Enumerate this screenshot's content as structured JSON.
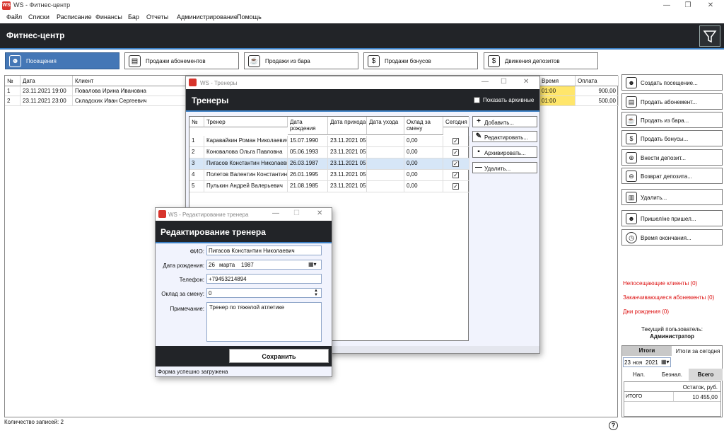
{
  "app": {
    "title": "WS - Фитнес-центр",
    "logo": "WS",
    "header_title": "Фитнес-центр"
  },
  "menu": [
    "Файл",
    "Списки",
    "Расписание",
    "Финансы",
    "Бар",
    "Отчеты",
    "Администрирование",
    "Помощь"
  ],
  "tabs": [
    {
      "label": "Посещения",
      "icon": "person-icon"
    },
    {
      "label": "Продажи абонементов",
      "icon": "ticket-icon"
    },
    {
      "label": "Продажи из бара",
      "icon": "cup-icon"
    },
    {
      "label": "Продажи бонусов",
      "icon": "dollar-icon"
    },
    {
      "label": "Движения депозитов",
      "icon": "dollar-icon"
    }
  ],
  "main_grid": {
    "columns": [
      "№",
      "Дата",
      "Клиент",
      "Время",
      "Оплата"
    ],
    "rows": [
      {
        "num": "1",
        "date": "23.11.2021 19:00",
        "client": "Повалова Ирина Ивановна",
        "time": "01:00",
        "pay": "900,00"
      },
      {
        "num": "2",
        "date": "23.11.2021 23:00",
        "client": "Складских Иван Сергеевич",
        "time": "01:00",
        "pay": "500,00"
      }
    ],
    "status": "Количество записей: 2"
  },
  "right_panel": {
    "buttons": [
      {
        "label": "Создать посещение...",
        "icon": "person-icon"
      },
      {
        "label": "Продать абонемент...",
        "icon": "ticket-icon"
      },
      {
        "label": "Продать из бара...",
        "icon": "cup-icon"
      },
      {
        "label": "Продать бонусы...",
        "icon": "dollar-icon"
      },
      {
        "label": "Внести депозит...",
        "icon": "deposit-icon"
      },
      {
        "label": "Возврат депозита...",
        "icon": "withdraw-icon"
      },
      {
        "label": "Удалить...",
        "icon": "trash-icon"
      },
      {
        "label": "Пришел/не пришел...",
        "icon": "person-check-icon"
      },
      {
        "label": "Время окончания...",
        "icon": "clock-icon"
      }
    ],
    "links": [
      "Непосещающие клиенты (0)",
      "Заканчивающиеся абонементы (0)",
      "Дни рождения (0)"
    ],
    "user_caption": "Текущий пользователь:",
    "user_name": "Администратор",
    "totals": {
      "tab_totals": "Итоги",
      "tab_today": "Итоги за сегодня",
      "date_day": "23",
      "date_month": "ноя",
      "date_year": "2021",
      "sub_tabs": [
        "Нал.",
        "Безнал.",
        "Всего"
      ],
      "col_header": "Остаток, руб.",
      "row_label": "ИТОГО",
      "row_value": "10 455,00"
    }
  },
  "trainers_window": {
    "title": "WS - Тренеры",
    "header": "Тренеры",
    "show_archived": "Показать архивные",
    "columns": [
      "№",
      "Тренер",
      "Дата рождения",
      "Дата прихода",
      "Дата ухода",
      "Оклад за смену",
      "Сегодня"
    ],
    "rows": [
      {
        "num": "1",
        "name": "Каравайкин Роман Николаевич",
        "birth": "15.07.1990",
        "hired": "23.11.2021 05",
        "left": "",
        "salary": "0,00",
        "today": true
      },
      {
        "num": "2",
        "name": "Коновалова Ольга Павловна",
        "birth": "05.06.1993",
        "hired": "23.11.2021 05",
        "left": "",
        "salary": "0,00",
        "today": true
      },
      {
        "num": "3",
        "name": "Пигасов Константин Николаевич",
        "birth": "26.03.1987",
        "hired": "23.11.2021 05",
        "left": "",
        "salary": "0,00",
        "today": true
      },
      {
        "num": "4",
        "name": "Полетов Валентин Константинович",
        "birth": "26.01.1995",
        "hired": "23.11.2021 05",
        "left": "",
        "salary": "0,00",
        "today": true
      },
      {
        "num": "5",
        "name": "Пулькин Андрей Валерьевич",
        "birth": "21.08.1985",
        "hired": "23.11.2021 05",
        "left": "",
        "salary": "0,00",
        "today": true
      }
    ],
    "selected_row": 2,
    "buttons": [
      {
        "label": "Добавить...",
        "icon": "plus-icon"
      },
      {
        "label": "Редактировать...",
        "icon": "pencil-icon"
      },
      {
        "label": "Архивировать...",
        "icon": "archive-icon"
      },
      {
        "label": "Удалить...",
        "icon": "minus-icon"
      }
    ]
  },
  "edit_window": {
    "title": "WS - Редактирование тренера",
    "header": "Редактирование тренера",
    "fio_label": "ФИО:",
    "fio_value": "Пигасов Константин Николаевич",
    "birth_label": "Дата рождения:",
    "birth_day": "26",
    "birth_month": "марта",
    "birth_year": "1987",
    "phone_label": "Телефон:",
    "phone_value": "+79453214894",
    "salary_label": "Оклад за смену:",
    "salary_value": "0",
    "note_label": "Примечание:",
    "note_value": "Тренер по тяжелой атлетике",
    "save_label": "Сохранить",
    "status": "Форма успешно загружена"
  },
  "colors": {
    "accent": "#4477b6",
    "header": "#222428",
    "highlight": "#ffe66b",
    "alert": "#dd1111"
  }
}
